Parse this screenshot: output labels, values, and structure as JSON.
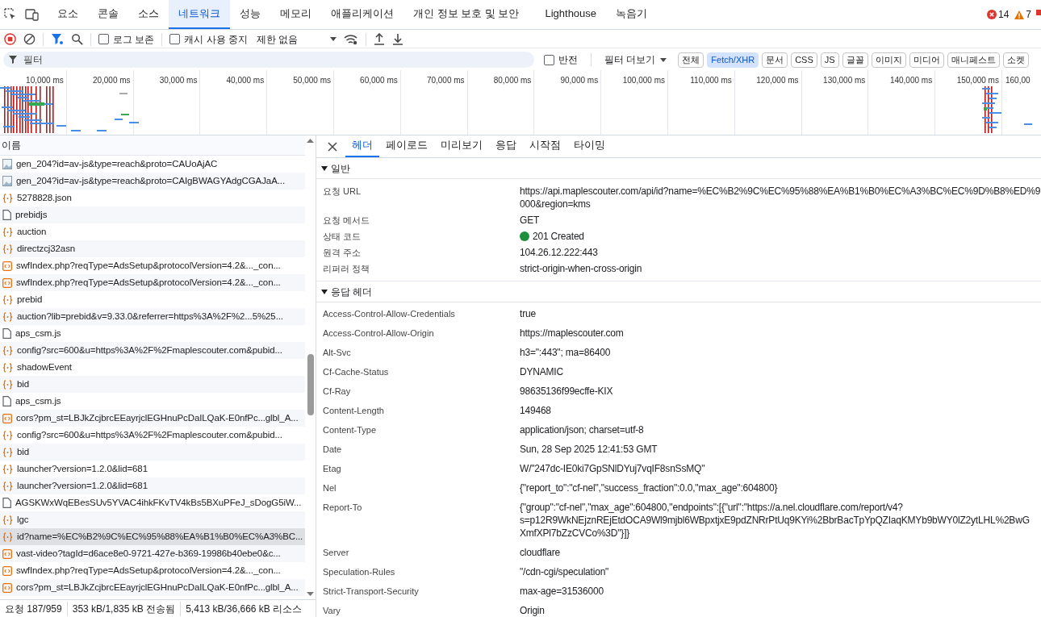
{
  "panel_tabs": [
    {
      "label": "요소",
      "selected": false
    },
    {
      "label": "콘솔",
      "selected": false
    },
    {
      "label": "소스",
      "selected": false
    },
    {
      "label": "네트워크",
      "selected": true
    },
    {
      "label": "성능",
      "selected": false
    },
    {
      "label": "메모리",
      "selected": false
    },
    {
      "label": "애플리케이션",
      "selected": false
    },
    {
      "label": "개인 정보 보호 및 보안",
      "selected": false
    },
    {
      "label": "Lighthouse",
      "selected": false
    },
    {
      "label": "녹음기",
      "selected": false
    }
  ],
  "counters": {
    "errors": "14",
    "warnings": "7"
  },
  "toolbar": {
    "preserve_log": {
      "label": "로그 보존",
      "checked": false
    },
    "disable_cache": {
      "label": "캐시 사용 중지",
      "checked": false
    },
    "throttling": "제한 없음"
  },
  "filter": {
    "placeholder": "필터",
    "invert": {
      "label": "반전",
      "checked": false
    },
    "more_filters": "필터 더보기",
    "types": [
      {
        "label": "전체",
        "selected": false
      },
      {
        "label": "Fetch/XHR",
        "selected": true
      },
      {
        "label": "문서",
        "selected": false
      },
      {
        "label": "CSS",
        "selected": false
      },
      {
        "label": "JS",
        "selected": false
      },
      {
        "label": "글꼴",
        "selected": false
      },
      {
        "label": "이미지",
        "selected": false
      },
      {
        "label": "미디어",
        "selected": false
      },
      {
        "label": "매니페스트",
        "selected": false
      },
      {
        "label": "소켓",
        "selected": false
      }
    ]
  },
  "timeline_ticks": [
    "10,000 ms",
    "20,000 ms",
    "30,000 ms",
    "40,000 ms",
    "50,000 ms",
    "60,000 ms",
    "70,000 ms",
    "80,000 ms",
    "90,000 ms",
    "100,000 ms",
    "110,000 ms",
    "120,000 ms",
    "130,000 ms",
    "140,000 ms",
    "150,000 ms",
    "160,00"
  ],
  "requests": {
    "column": "이름",
    "rows": [
      {
        "name": "gen_204?id=av-js&type=reach&proto=CAUoAjAC",
        "kind": "image",
        "selected": false
      },
      {
        "name": "gen_204?id=av-js&type=reach&proto=CAIgBWAGYAdgCGAJaA...",
        "kind": "image",
        "selected": false
      },
      {
        "name": "5278828.json",
        "kind": "fetch",
        "selected": false
      },
      {
        "name": "prebidjs",
        "kind": "document",
        "selected": false
      },
      {
        "name": "auction",
        "kind": "fetch",
        "selected": false
      },
      {
        "name": "directzcj32asn",
        "kind": "fetch",
        "selected": false
      },
      {
        "name": "swfIndex.php?reqType=AdsSetup&protocolVersion=4.2&..._con...",
        "kind": "xml",
        "selected": false
      },
      {
        "name": "swfIndex.php?reqType=AdsSetup&protocolVersion=4.2&..._con...",
        "kind": "xml",
        "selected": false
      },
      {
        "name": "prebid",
        "kind": "fetch",
        "selected": false
      },
      {
        "name": "auction?lib=prebid&v=9.33.0&referrer=https%3A%2F%2...5%25...",
        "kind": "fetch",
        "selected": false
      },
      {
        "name": "aps_csm.js",
        "kind": "document",
        "selected": false
      },
      {
        "name": "config?src=600&u=https%3A%2F%2Fmaplescouter.com&pubid...",
        "kind": "fetch",
        "selected": false
      },
      {
        "name": "shadowEvent",
        "kind": "fetch",
        "selected": false
      },
      {
        "name": "bid",
        "kind": "fetch",
        "selected": false
      },
      {
        "name": "aps_csm.js",
        "kind": "document",
        "selected": false
      },
      {
        "name": "cors?pm_st=LBJkZcjbrcEEayrjclEGHnuPcDaILQaK-E0nfPc...glbl_A...",
        "kind": "xml",
        "selected": false
      },
      {
        "name": "config?src=600&u=https%3A%2F%2Fmaplescouter.com&pubid...",
        "kind": "fetch",
        "selected": false
      },
      {
        "name": "bid",
        "kind": "fetch",
        "selected": false
      },
      {
        "name": "launcher?version=1.2.0&lid=681",
        "kind": "fetch",
        "selected": false
      },
      {
        "name": "launcher?version=1.2.0&lid=681",
        "kind": "fetch",
        "selected": false
      },
      {
        "name": "AGSKWxWqEBesSUv5YVAC4ihkFKvTV4kBs5BXuPFeJ_sDogG5iW...",
        "kind": "document",
        "selected": false
      },
      {
        "name": "lgc",
        "kind": "fetch",
        "selected": false
      },
      {
        "name": "id?name=%EC%B2%9C%EC%95%88%EA%B1%B0%EC%A3%BC...",
        "kind": "fetch",
        "selected": true
      },
      {
        "name": "vast-video?tagId=d6ace8e0-9721-427e-b369-19986b40ebe0&c...",
        "kind": "xml",
        "selected": false
      },
      {
        "name": "swfIndex.php?reqType=AdsSetup&protocolVersion=4.2&..._con...",
        "kind": "xml",
        "selected": false
      },
      {
        "name": "cors?pm_st=LBJkZcjbrcEEayrjclEGHnuPcDaILQaK-E0nfPc...glbl_A...",
        "kind": "xml",
        "selected": false
      }
    ]
  },
  "status_bar": [
    "요청 187/959",
    "353 kB/1,835 kB 전송됨",
    "5,413 kB/36,666 kB 리소스"
  ],
  "detail_tabs": [
    {
      "label": "헤더",
      "selected": true
    },
    {
      "label": "페이로드",
      "selected": false
    },
    {
      "label": "미리보기",
      "selected": false
    },
    {
      "label": "응답",
      "selected": false
    },
    {
      "label": "시작점",
      "selected": false
    },
    {
      "label": "타이밍",
      "selected": false
    }
  ],
  "sections": [
    {
      "title": "일반",
      "expanded": true,
      "kind": "general",
      "rows": [
        {
          "name": "요청 URL",
          "value": [
            "https://api.maplescouter.com/api/id?name=%EC%B2%9C%EC%95%88%EA%B1%B0%EC%A3%BC%EC%9D%B8%ED%9",
            "000&region=kms"
          ]
        },
        {
          "name": "요청 메서드",
          "value": [
            "GET"
          ]
        },
        {
          "name": "상태 코드",
          "value": [
            "201 Created"
          ],
          "color": "#1e8e3e"
        },
        {
          "name": "원격 주소",
          "value": [
            "104.26.12.222:443"
          ]
        },
        {
          "name": "리퍼러 정책",
          "value": [
            "strict-origin-when-cross-origin"
          ]
        }
      ]
    },
    {
      "title": "응답 헤더",
      "expanded": true,
      "kind": "headers",
      "rows": [
        {
          "name": "Access-Control-Allow-Credentials",
          "value": [
            "true"
          ]
        },
        {
          "name": "Access-Control-Allow-Origin",
          "value": [
            "https://maplescouter.com"
          ]
        },
        {
          "name": "Alt-Svc",
          "value": [
            "h3=\":443\"; ma=86400"
          ]
        },
        {
          "name": "Cf-Cache-Status",
          "value": [
            "DYNAMIC"
          ]
        },
        {
          "name": "Cf-Ray",
          "value": [
            "98635136f99ecffe-KIX"
          ]
        },
        {
          "name": "Content-Length",
          "value": [
            "149468"
          ]
        },
        {
          "name": "Content-Type",
          "value": [
            "application/json; charset=utf-8"
          ]
        },
        {
          "name": "Date",
          "value": [
            "Sun, 28 Sep 2025 12:41:53 GMT"
          ]
        },
        {
          "name": "Etag",
          "value": [
            "W/\"247dc-IE0ki7GpSNlDYuj7vqIF8snSsMQ\""
          ]
        },
        {
          "name": "Nel",
          "value": [
            "{\"report_to\":\"cf-nel\",\"success_fraction\":0.0,\"max_age\":604800}"
          ]
        },
        {
          "name": "Report-To",
          "value": [
            "{\"group\":\"cf-nel\",\"max_age\":604800,\"endpoints\":[{\"url\":\"https://a.nel.cloudflare.com/report/v4?",
            "s=p12R9WkNEjznREjEtdOCA9Wl9mjbl6WBpxtjxE9pdZNRrPtUq9KYi%2BbrBacTpYpQZIaqKMYb9bWY0lZ2ytLHL%2BwG",
            "XmfXPl7bZzCVCo%3D\"}]}"
          ]
        },
        {
          "name": "Server",
          "value": [
            "cloudflare"
          ]
        },
        {
          "name": "Speculation-Rules",
          "value": [
            "\"/cdn-cgi/speculation\""
          ]
        },
        {
          "name": "Strict-Transport-Security",
          "value": [
            "max-age=31536000"
          ]
        },
        {
          "name": "Vary",
          "value": [
            "Origin"
          ]
        }
      ]
    }
  ]
}
